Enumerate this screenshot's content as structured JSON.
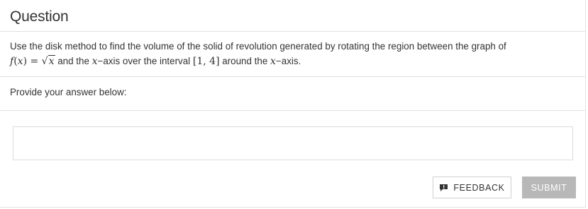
{
  "header": {
    "title": "Question"
  },
  "question": {
    "line1": "Use the disk method to find the volume of the solid of revolution generated by rotating the region between the graph of",
    "func_f": "f",
    "func_x": "x",
    "equals": "=",
    "sqrt_arg": "x",
    "and_the": " and the ",
    "x_var": "x",
    "dash_axis": "−axis over the interval ",
    "interval": "[1, 4]",
    "around_the": " around the ",
    "x_var2": "x",
    "dash_axis2": "−axis."
  },
  "answer": {
    "prompt": "Provide your answer below:",
    "value": "",
    "placeholder": ""
  },
  "actions": {
    "feedback_label": "FEEDBACK",
    "submit_label": "SUBMIT",
    "feedback_icon": "speech-bubble-alert-icon"
  },
  "colors": {
    "submit_disabled": "#b8b8b8",
    "text": "#333333",
    "border": "#e0e0e0"
  }
}
